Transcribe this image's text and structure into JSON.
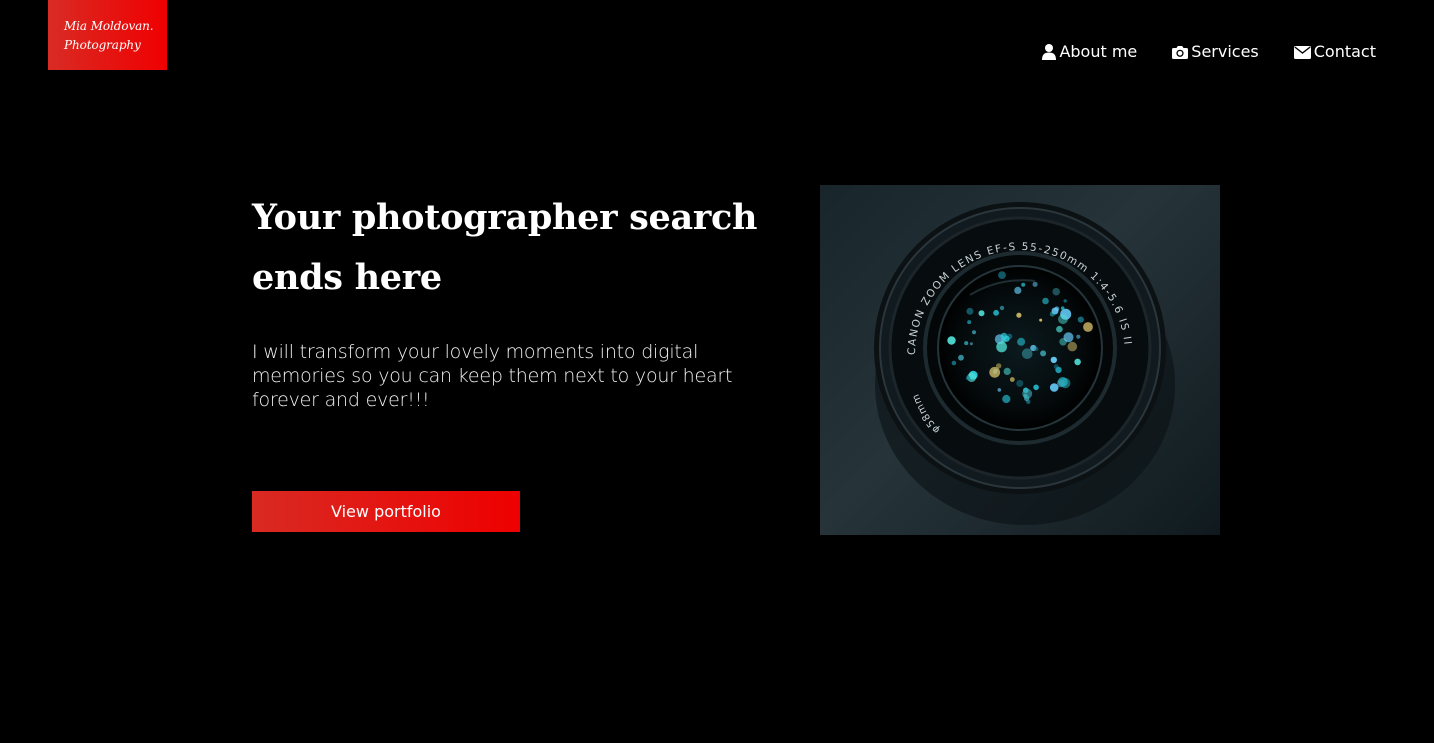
{
  "brand": {
    "line1": "Mia Moldovan.",
    "line2": "Photography",
    "color_start": "#d92b24",
    "color_end": "#ef0000"
  },
  "nav": {
    "items": [
      {
        "label": "About me",
        "icon": "user-icon"
      },
      {
        "label": "Services",
        "icon": "camera-icon"
      },
      {
        "label": "Contact",
        "icon": "envelope-icon"
      }
    ]
  },
  "hero": {
    "title": "Your photographer search ends here",
    "text": "I will transform your lovely moments into digital memories so you can keep them next to your heart forever and ever!!!",
    "button_label": "View portfolio",
    "image": {
      "subject": "camera-lens",
      "ring_text_top": "CANON ZOOM LENS EF-S 55-250mm 1:4-5.6 IS II",
      "ring_text_left": "φ58mm"
    }
  },
  "colors": {
    "background": "#000000",
    "accent": "#ee0000",
    "text": "#ffffff"
  }
}
